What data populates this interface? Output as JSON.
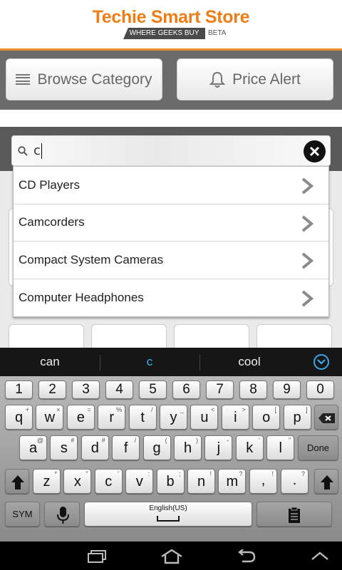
{
  "header": {
    "title": "Techie Smart Store",
    "tagline": "WHERE GEEKS BUY",
    "badge": "BETA"
  },
  "actions": {
    "browse_label": "Browse Category",
    "price_alert_label": "Price Alert"
  },
  "search": {
    "query": "c"
  },
  "suggestions": [
    {
      "label": "CD Players"
    },
    {
      "label": "Camcorders"
    },
    {
      "label": "Compact System Cameras"
    },
    {
      "label": "Computer Headphones"
    }
  ],
  "keyboard": {
    "word_suggestions": [
      "can",
      "c",
      "cool"
    ],
    "number_row": [
      "1",
      "2",
      "3",
      "4",
      "5",
      "6",
      "7",
      "8",
      "9",
      "0"
    ],
    "row1": [
      {
        "k": "q",
        "a": "+"
      },
      {
        "k": "w",
        "a": "×"
      },
      {
        "k": "e",
        "a": "="
      },
      {
        "k": "r",
        "a": "%"
      },
      {
        "k": "t",
        "a": "/"
      },
      {
        "k": "y",
        "a": "_"
      },
      {
        "k": "u",
        "a": "<"
      },
      {
        "k": "i",
        "a": ">"
      },
      {
        "k": "o",
        "a": "["
      },
      {
        "k": "p",
        "a": "]"
      }
    ],
    "row2": [
      {
        "k": "a",
        "a": "@"
      },
      {
        "k": "s",
        "a": "#"
      },
      {
        "k": "d",
        "a": "#"
      },
      {
        "k": "f",
        "a": "/"
      },
      {
        "k": "g",
        "a": "("
      },
      {
        "k": "h",
        "a": ")"
      },
      {
        "k": "j",
        "a": "-"
      },
      {
        "k": "k",
        "a": "'"
      },
      {
        "k": "l",
        "a": "\""
      }
    ],
    "row3": [
      {
        "k": "z",
        "a": "*"
      },
      {
        "k": "x",
        "a": "\""
      },
      {
        "k": "c",
        "a": "'"
      },
      {
        "k": "v",
        "a": ":"
      },
      {
        "k": "b",
        "a": ";"
      },
      {
        "k": "n",
        "a": "!"
      },
      {
        "k": "m",
        "a": "?"
      }
    ],
    "done_label": "Done",
    "sym_label": "SYM",
    "space_label": "English(US)",
    "comma": ",",
    "comma_alt": "!",
    "period": ".",
    "period_alt": "?"
  },
  "icons": {
    "menu": "menu-icon",
    "bell": "bell-icon",
    "search": "search-icon",
    "clear": "clear-icon",
    "chevron": "chevron-right-icon",
    "backspace": "backspace-icon",
    "shift": "shift-icon",
    "mic": "microphone-icon",
    "clipboard": "clipboard-icon",
    "recents": "recent-apps-icon",
    "home": "home-icon",
    "back": "back-icon"
  },
  "colors": {
    "brand_orange": "#ef7d16",
    "suggestion_highlight": "#35b6f0"
  }
}
